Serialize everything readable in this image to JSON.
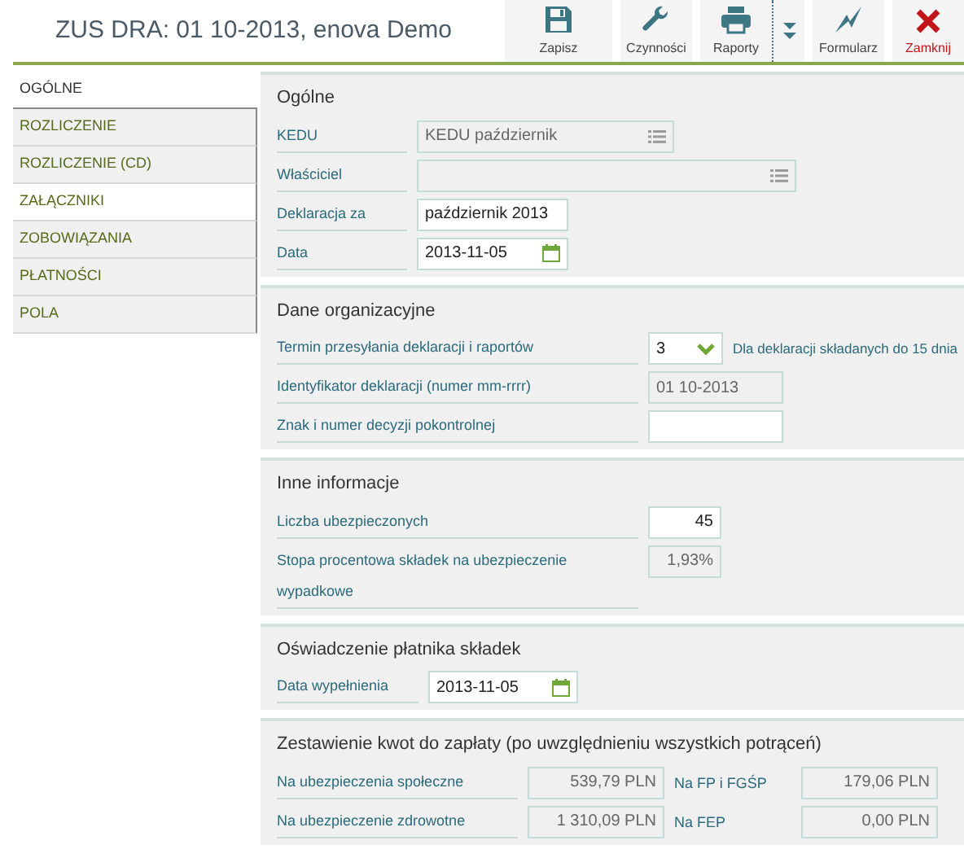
{
  "window": {
    "title": "ZUS DRA: 01 10-2013, enova Demo"
  },
  "toolbar": [
    {
      "kind": "save",
      "label": "Zapisz",
      "danger": false
    },
    {
      "kind": "tools",
      "label": "Czynności",
      "danger": false
    },
    {
      "kind": "print",
      "label": "Raporty",
      "danger": false,
      "dropdown": true
    },
    {
      "kind": "form",
      "label": "Formularz",
      "danger": false
    },
    {
      "kind": "close",
      "label": "Zamknij",
      "danger": true
    }
  ],
  "sidebar": {
    "items": [
      {
        "label": "OGÓLNE",
        "selected": true,
        "hovered": false
      },
      {
        "label": "ROZLICZENIE",
        "selected": false,
        "hovered": false
      },
      {
        "label": "ROZLICZENIE (CD)",
        "selected": false,
        "hovered": false
      },
      {
        "label": "ZAŁĄCZNIKI",
        "selected": false,
        "hovered": true
      },
      {
        "label": "ZOBOWIĄZANIA",
        "selected": false,
        "hovered": false
      },
      {
        "label": "PŁATNOŚCI",
        "selected": false,
        "hovered": false
      },
      {
        "label": "POLA",
        "selected": false,
        "hovered": false
      }
    ]
  },
  "sections": [
    {
      "title": "Ogólne",
      "rows": [
        {
          "label": "KEDU",
          "field": {
            "kind": "lookup",
            "value": "KEDU październik"
          }
        },
        {
          "label": "Właściciel",
          "field": {
            "kind": "lookup"
          }
        },
        {
          "label": "Deklaracja za",
          "field": {
            "kind": "text",
            "value": "październik 2013"
          }
        },
        {
          "label": "Data",
          "field": {
            "kind": "date",
            "value": "2013-11-05"
          }
        }
      ]
    },
    {
      "title": "Dane organizacyjne",
      "rows": [
        {
          "label": "Termin przesyłania deklaracji i raportów",
          "field": {
            "kind": "select",
            "value": "3"
          },
          "note": "Dla deklaracji składanych do 15 dnia"
        },
        {
          "label": "Identyfikator deklaracji (numer mm-rrrr)",
          "field": {
            "kind": "readonly",
            "value": "01 10-2013"
          }
        },
        {
          "label": "Znak i numer decyzji pokontrolnej",
          "field": {
            "kind": "text"
          }
        }
      ]
    },
    {
      "title": "Inne informacje",
      "rows": [
        {
          "label": "Liczba ubezpieczonych",
          "field": {
            "kind": "text",
            "value": "45",
            "numeric": true
          }
        },
        {
          "label": "Stopa procentowa składek na ubezpieczenie wypadkowe",
          "field": {
            "kind": "readonly",
            "value": "1,93%",
            "numeric": true
          }
        }
      ]
    },
    {
      "title": "Oświadczenie płatnika składek",
      "rows": [
        {
          "label": "Data wypełnienia",
          "field": {
            "kind": "date",
            "value": "2013-11-05"
          }
        }
      ]
    },
    {
      "title": "Zestawienie kwot do zapłaty (po uwzględnieniu wszystkich potrąceń)",
      "rows": [
        {
          "label": "Na ubezpieczenia społeczne",
          "field": {
            "kind": "readonly",
            "value": "539,79 PLN",
            "numeric": true
          },
          "label2": "Na FP i FGŚP",
          "field2": {
            "kind": "readonly",
            "value": "179,06 PLN",
            "numeric": true
          }
        },
        {
          "label": "Na ubezpieczenie zdrowotne",
          "field": {
            "kind": "readonly",
            "value": "1 310,09 PLN",
            "numeric": true
          },
          "label2": "Na FEP",
          "field2": {
            "kind": "readonly",
            "value": "0,00 PLN",
            "numeric": true
          }
        }
      ]
    }
  ]
}
